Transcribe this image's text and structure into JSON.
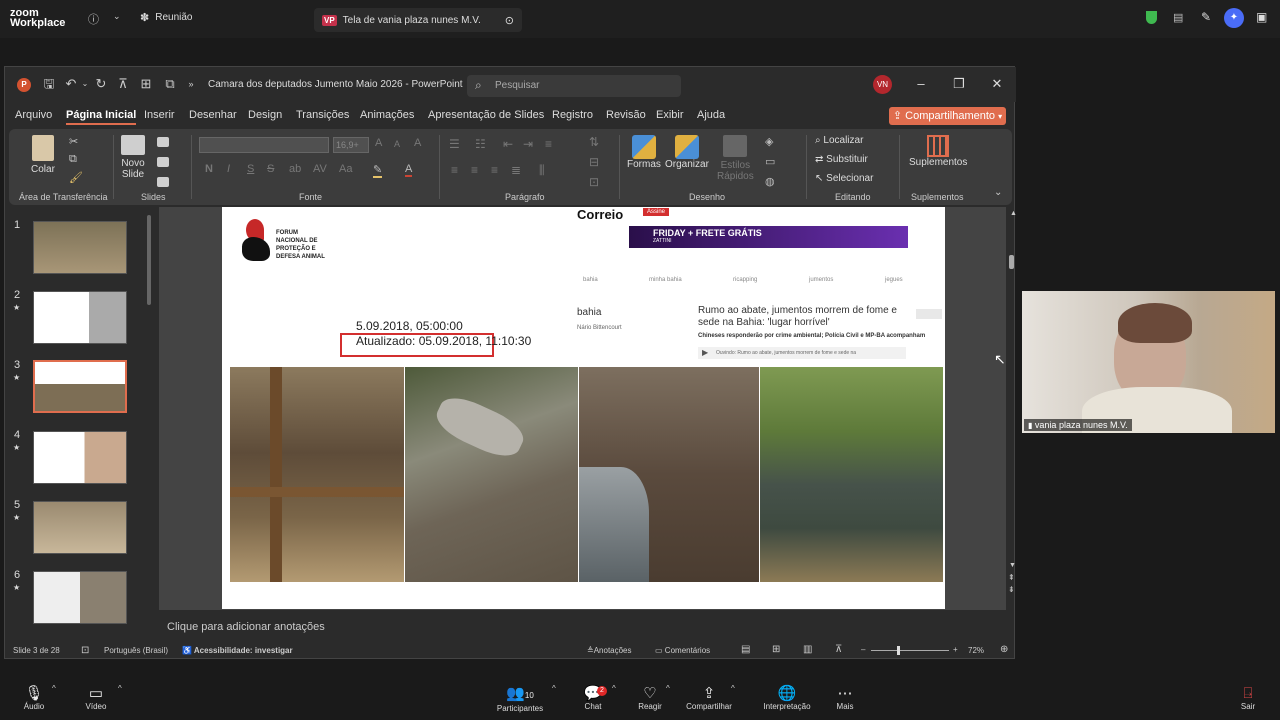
{
  "zoom": {
    "logo_top": "zoom",
    "logo_bottom": "Workplace",
    "meeting_tab": "Reunião",
    "share_tab_badge": "VP",
    "share_tab": "Tela de vania plaza nunes M.V."
  },
  "ppt": {
    "app_icon": "P",
    "title": "Camara dos deputados Jumento Maio 2026  -  PowerPoint",
    "search_placeholder": "Pesquisar",
    "user_initials": "VN",
    "tabs": [
      "Arquivo",
      "Página Inicial",
      "Inserir",
      "Desenhar",
      "Design",
      "Transições",
      "Animações",
      "Apresentação de Slides",
      "Registro",
      "Revisão",
      "Exibir",
      "Ajuda"
    ],
    "share_button": "Compartilhamento",
    "ribbon": {
      "colar": "Colar",
      "novo_slide": "Novo",
      "novo_slide_2": "Slide",
      "font_size": "16,9+",
      "formas": "Formas",
      "organizar": "Organizar",
      "estilos": "Estilos",
      "estilos_2": "Rápidos",
      "localizar": "Localizar",
      "substituir": "Substituir",
      "selecionar": "Selecionar",
      "suplementos": "Suplementos",
      "groups": [
        "Área de Transferência",
        "Slides",
        "Fonte",
        "Parágrafo",
        "Desenho",
        "Editando",
        "Suplementos"
      ]
    },
    "slides": [
      "1",
      "2",
      "3",
      "4",
      "5",
      "6"
    ],
    "selected_slide": "3",
    "slide": {
      "forum_lines": [
        "FORUM",
        "NACIONAL DE",
        "PROTEÇÃO E",
        "DEFESA ANIMAL"
      ],
      "date_published": "5.09.2018, 05:00:00",
      "date_updated": "Atualizado: 05.09.2018, 11:10:30",
      "correio_logo": "Correio",
      "assine": "Assine",
      "banner_text": "FRIDAY + FRETE GRÁTIS",
      "banner_sub": "ZATTINI",
      "nav_items": [
        "bahia",
        "minha bahia",
        "ricapping",
        "jumentos",
        "jegues"
      ],
      "headline": "Rumo ao abate, jumentos morrem de fome e sede na Bahia: 'lugar horrível'",
      "section": "bahia",
      "author": "Nário Bittencourt",
      "subhead": "Chineses responderão por crime ambiental; Polícia Civil e MP-BA acompanham",
      "audio_label": "Ouvindo: Rumo ao abate, jumentos morrem de fome e sede na"
    },
    "notes_placeholder": "Clique para adicionar anotações",
    "status": {
      "slide_count": "Slide 3 de 28",
      "language": "Português (Brasil)",
      "accessibility": "Acessibilidade: investigar",
      "notes": "Anotações",
      "comments": "Comentários",
      "zoom": "72%"
    }
  },
  "participant": {
    "name": "vania plaza nunes M.V."
  },
  "toolbar": {
    "audio": "Áudio",
    "video": "Vídeo",
    "participants": "Participantes",
    "participants_count": "10",
    "chat": "Chat",
    "chat_badge": "2",
    "react": "Reagir",
    "share": "Compartilhar",
    "interp": "Interpretação",
    "more": "Mais",
    "leave": "Sair"
  }
}
